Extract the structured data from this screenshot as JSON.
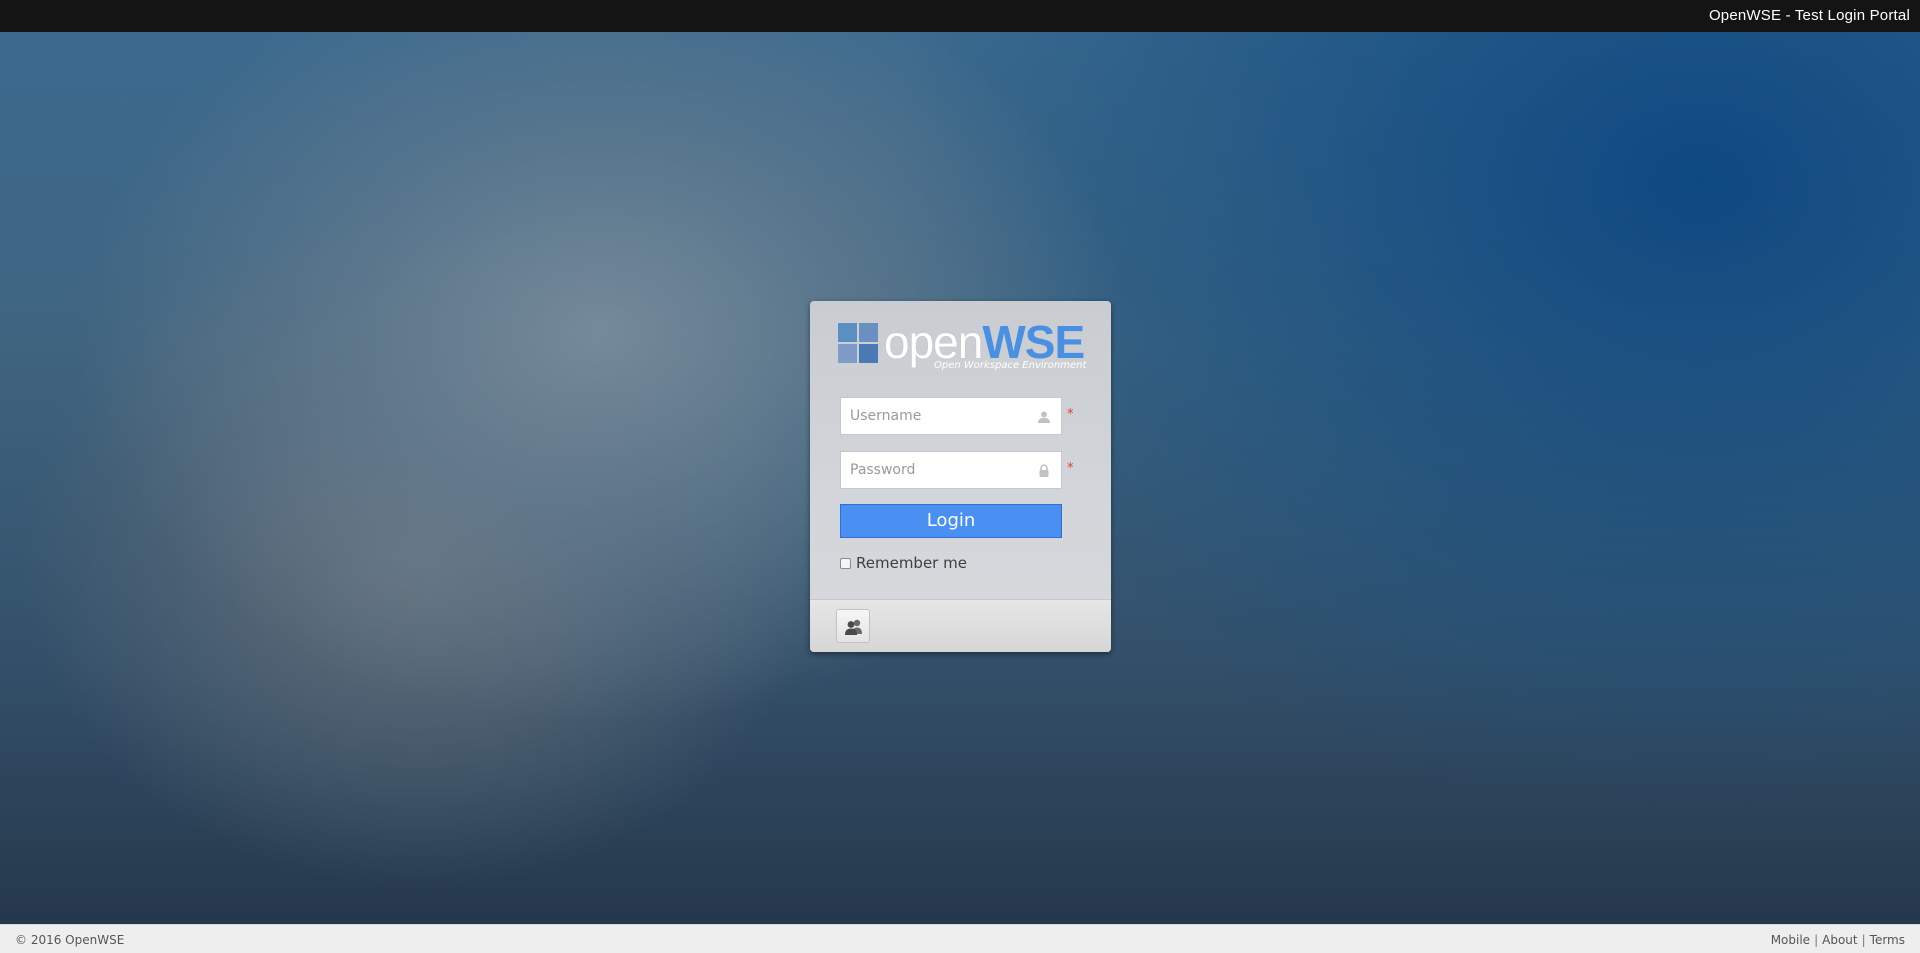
{
  "topbar": {
    "title": "OpenWSE - Test Login Portal"
  },
  "logo": {
    "word_open": "open",
    "word_wse": "WSE",
    "tagline": "Open Workspace Environment",
    "square_colors": [
      "#5b8fc2",
      "#6a8fc0",
      "#7e9cc8",
      "#4a79b5"
    ]
  },
  "form": {
    "username": {
      "placeholder": "Username",
      "value": "",
      "icon": "user-icon",
      "required_mark": "*"
    },
    "password": {
      "placeholder": "Password",
      "value": "",
      "icon": "lock-icon",
      "required_mark": "*"
    },
    "login_label": "Login",
    "remember_label": "Remember me",
    "remember_checked": false
  },
  "card_footer": {
    "button_icon": "user-group-icon"
  },
  "footer": {
    "copyright": "© 2016 OpenWSE",
    "links": [
      "Mobile",
      "About",
      "Terms"
    ],
    "separator": "|"
  },
  "colors": {
    "accent": "#4a90f2",
    "topbar": "#141414",
    "required": "#e53935"
  }
}
